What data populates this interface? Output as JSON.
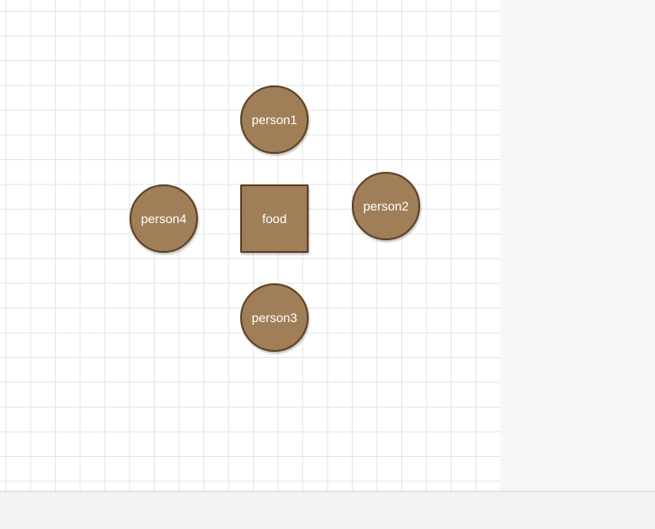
{
  "nodes": [
    {
      "id": "person1",
      "label": "person1",
      "shape": "circle"
    },
    {
      "id": "person2",
      "label": "person2",
      "shape": "circle"
    },
    {
      "id": "food",
      "label": "food",
      "shape": "square"
    },
    {
      "id": "person3",
      "label": "person3",
      "shape": "circle"
    },
    {
      "id": "person4",
      "label": "person4",
      "shape": "circle"
    }
  ],
  "colors": {
    "node_fill": "#a07f58",
    "node_border": "#5c4226",
    "node_text": "#ffffff",
    "grid_line": "#e6e6e6",
    "canvas_bg": "#ffffff",
    "panel_bg": "#f7f7f7"
  }
}
